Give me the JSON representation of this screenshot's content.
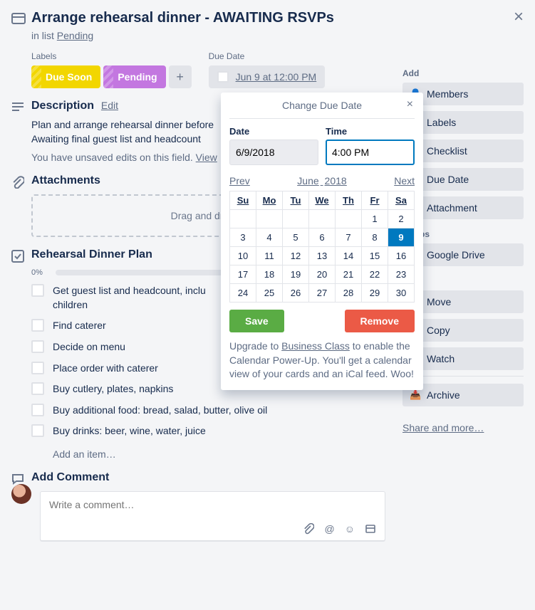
{
  "card": {
    "title": "Arrange rehearsal dinner - AWAITING RSVPs",
    "in_list_prefix": "in list ",
    "list_name": "Pending"
  },
  "labels": {
    "heading": "Labels",
    "items": [
      "Due Soon",
      "Pending"
    ]
  },
  "due": {
    "heading": "Due Date",
    "display": "Jun 9 at 12:00 PM"
  },
  "description": {
    "heading": "Description",
    "edit": "Edit",
    "text": "Plan and arrange rehearsal dinner before\nAwaiting final guest list and headcount",
    "unsaved": "You have unsaved edits on this field. ",
    "view": "View"
  },
  "attachments": {
    "heading": "Attachments",
    "drop": "Drag and drop or"
  },
  "checklist": {
    "heading": "Rehearsal Dinner Plan",
    "percent": "0%",
    "items": [
      "Get guest list and headcount, inclu\nchildren",
      "Find caterer",
      "Decide on menu",
      "Place order with caterer",
      "Buy cutlery, plates, napkins",
      "Buy additional food: bread, salad, butter, olive oil",
      "Buy drinks: beer, wine, water, juice"
    ],
    "add_item": "Add an item…"
  },
  "comment": {
    "heading": "Add Comment",
    "placeholder": "Write a comment…"
  },
  "sidebar": {
    "add_heading": "Add",
    "add_items": [
      "Members",
      "Labels",
      "Checklist",
      "Due Date",
      "Attachment"
    ],
    "powerups_heading": "er-Ups",
    "powerups_items": [
      "Google Drive"
    ],
    "actions_heading": "ons",
    "actions_items": [
      "Move",
      "Copy",
      "Watch",
      "Archive"
    ],
    "share": "Share and more…"
  },
  "datepicker": {
    "title": "Change Due Date",
    "date_label": "Date",
    "time_label": "Time",
    "date_value": "6/9/2018",
    "time_value": "4:00 PM",
    "prev": "Prev",
    "month": "June",
    "year": "2018",
    "next": "Next",
    "weekdays": [
      "Su",
      "Mo",
      "Tu",
      "We",
      "Th",
      "Fr",
      "Sa"
    ],
    "weeks": [
      [
        "",
        "",
        "",
        "",
        "",
        "1",
        "2"
      ],
      [
        "3",
        "4",
        "5",
        "6",
        "7",
        "8",
        "9"
      ],
      [
        "10",
        "11",
        "12",
        "13",
        "14",
        "15",
        "16"
      ],
      [
        "17",
        "18",
        "19",
        "20",
        "21",
        "22",
        "23"
      ],
      [
        "24",
        "25",
        "26",
        "27",
        "28",
        "29",
        "30"
      ]
    ],
    "selected": "9",
    "save": "Save",
    "remove": "Remove",
    "footer_pre": "Upgrade to ",
    "footer_link": "Business Class",
    "footer_post": " to enable the Calendar Power-Up. You'll get a calendar view of your cards and an iCal feed. Woo!"
  }
}
